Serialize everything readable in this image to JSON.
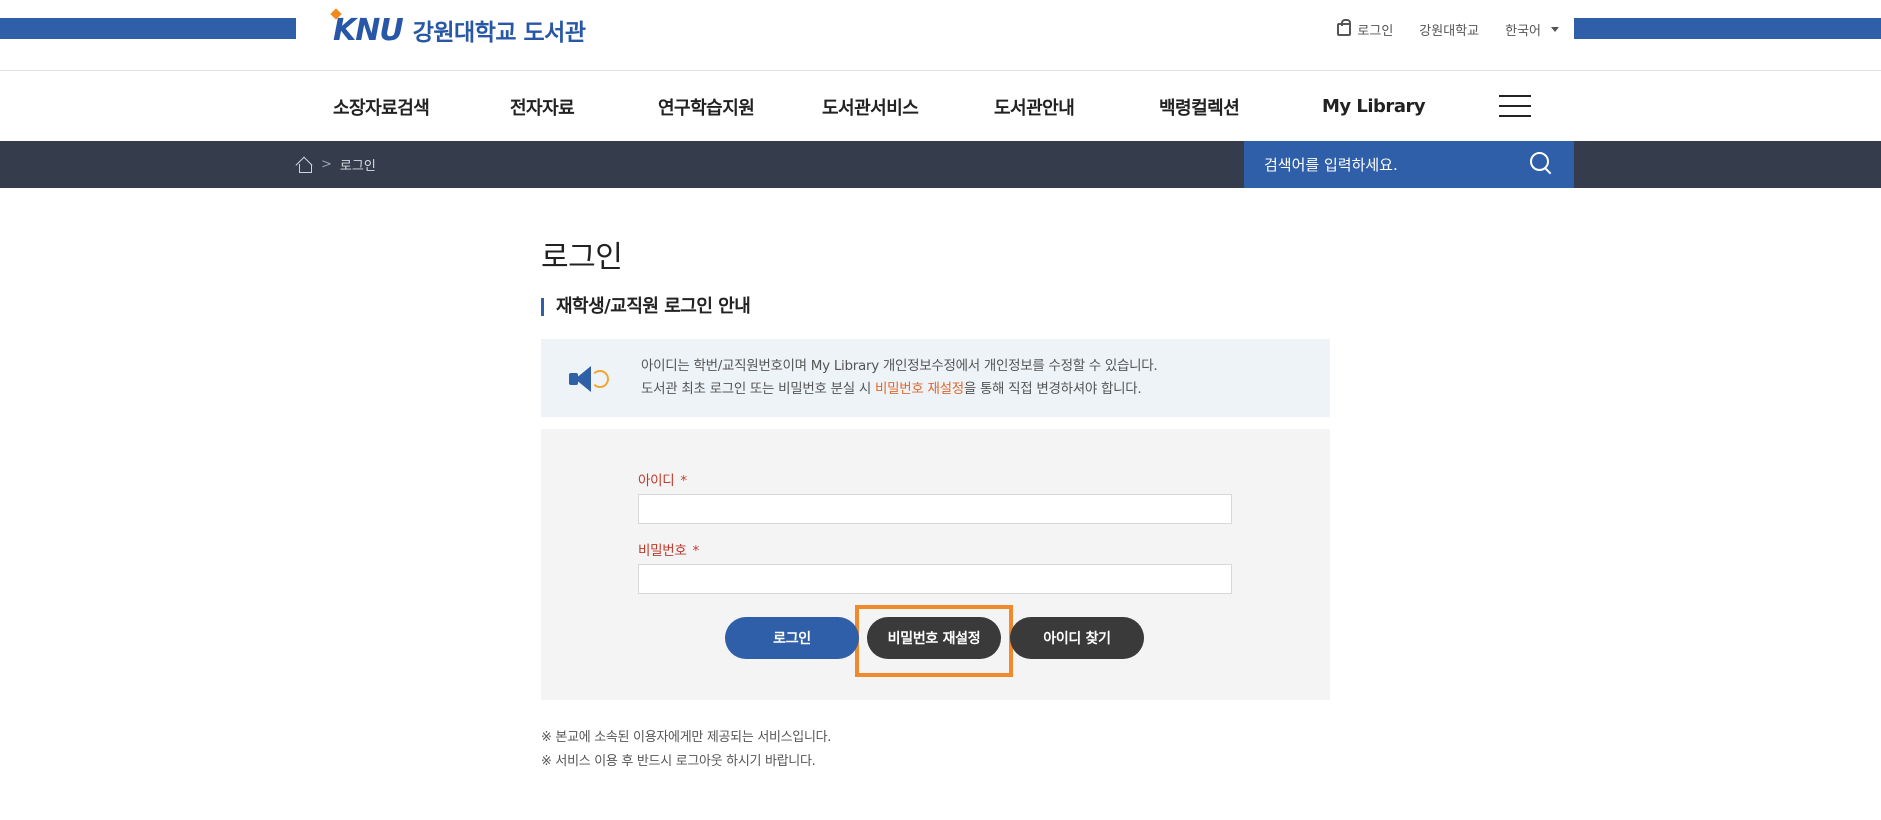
{
  "header": {
    "logo_mark": "KNU",
    "logo_text": "강원대학교 도서관",
    "util": {
      "login": "로그인",
      "university": "강원대학교",
      "language": "한국어"
    },
    "brand_color": "#2f5fa8",
    "accent_color": "#f08a1d"
  },
  "gnb": {
    "items": [
      "소장자료검색",
      "전자자료",
      "연구학습지원",
      "도서관서비스",
      "도서관안내",
      "백령컬렉션",
      "My Library"
    ],
    "menu_icon": "hamburger-icon"
  },
  "breadcrumb": {
    "home_icon": "home-icon",
    "current": "로그인"
  },
  "search": {
    "placeholder": "검색어를 입력하세요.",
    "icon": "search-icon"
  },
  "main": {
    "title": "로그인",
    "section_title": "재학생/교직원 로그인 안내",
    "notice": {
      "icon": "speaker-icon",
      "line1": "아이디는 학번/교직원번호이며 My Library 개인정보수정에서 개인정보를 수정할 수 있습니다.",
      "line2_pre": "도서관 최초 로그인 또는 비밀번호 분실 시 ",
      "line2_link": "비밀번호 재설정",
      "line2_post": "을 통해 직접 변경하셔야 합니다."
    },
    "form": {
      "id_label": "아이디",
      "pw_label": "비밀번호",
      "required_mark": "*",
      "id_value": "",
      "pw_value": "",
      "login_button": "로그인",
      "reset_button": "비밀번호 재설정",
      "find_id_button": "아이디 찾기",
      "highlight_color": "#f08a2c"
    },
    "footnotes": [
      "※ 본교에 소속된 이용자에게만 제공되는 서비스입니다.",
      "※ 서비스 이용 후 반드시 로그아웃 하시기 바랍니다."
    ]
  }
}
